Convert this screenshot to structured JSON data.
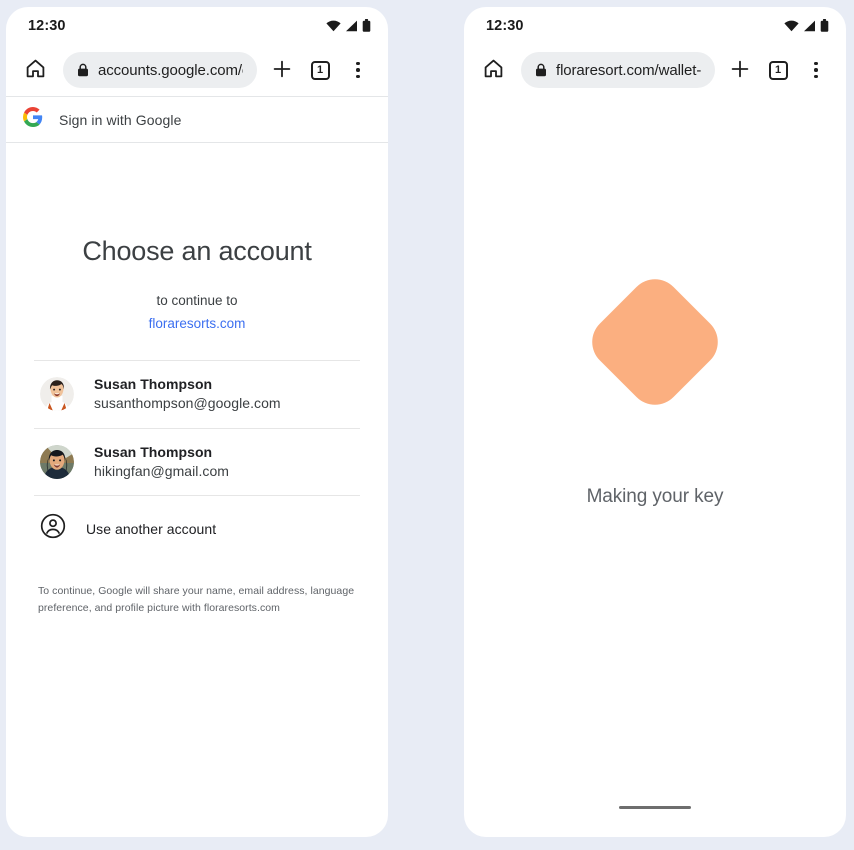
{
  "background_color": "#e8ecf5",
  "top_artifact": {
    "left": "...",
    "right": "..."
  },
  "left_phone": {
    "status_bar": {
      "time": "12:30",
      "icons": [
        "wifi-icon",
        "cellular-signal-icon",
        "battery-icon"
      ]
    },
    "toolbar": {
      "home_icon": "home-icon",
      "lock_icon": "lock-icon",
      "url": "accounts.google.com/o/",
      "new_tab_label": "+",
      "tab_count": "1",
      "menu_icon": "kebab-menu-icon"
    },
    "google_header": {
      "logo": "google-g-logo",
      "label": "Sign in with Google"
    },
    "chooser": {
      "title": "Choose an account",
      "subtitle": "to continue to",
      "domain": "floraresorts.com",
      "accounts": [
        {
          "name": "Susan Thompson",
          "email": "susanthompson@google.com",
          "avatar": "photo-avatar-white-top"
        },
        {
          "name": "Susan Thompson",
          "email": "hikingfan@gmail.com",
          "avatar": "photo-avatar-outdoors"
        }
      ],
      "use_another_account": "Use another account",
      "use_another_icon": "account-circle-icon",
      "disclaimer": "To continue, Google will share your name, email address, language preference, and profile picture with floraresorts.com",
      "link_color": "#3c6ff0"
    }
  },
  "right_phone": {
    "status_bar": {
      "time": "12:30",
      "icons": [
        "wifi-icon",
        "cellular-signal-icon",
        "battery-icon"
      ]
    },
    "toolbar": {
      "home_icon": "home-icon",
      "lock_icon": "lock-icon",
      "url": "floraresort.com/wallet-",
      "new_tab_label": "+",
      "tab_count": "1",
      "menu_icon": "kebab-menu-icon"
    },
    "key_page": {
      "shape": "rotated-rounded-square",
      "shape_color": "#fbaf80",
      "label": "Making your key"
    }
  }
}
